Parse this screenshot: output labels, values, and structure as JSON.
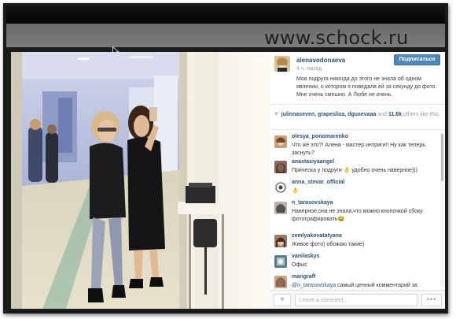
{
  "watermark": "www.schock.ru",
  "post": {
    "username": "alenavodonaeva",
    "time": "4 ч. назад",
    "follow_label": "Подписаться",
    "caption": "Моя подруга никогда до этого не знала об одном явлении, о котором я поведала ей за секунду до фото. Мне очень смешно. А Любе не очень."
  },
  "likes": {
    "users": "julinnaseven, grapesliza, dgusevaaa",
    "connector": " and ",
    "count": "11.6k",
    "suffix": " others like this."
  },
  "comments": [
    {
      "user": "olesya_ponomarenko",
      "text": "Что же это?! Алена - мастер интриги!! Ну как теперь заснуть?"
    },
    {
      "user": "anastasiyaangel",
      "text": "Прическа у подруги 👌 удобно очень наверное)))"
    },
    {
      "user": "anna_stevar_official",
      "text": "👌"
    },
    {
      "user": "n_tarasovskaya",
      "text": "Наверное,она не знала,что можно кнопочкой сбоку фотографировать😂"
    },
    {
      "user": "zemlyakovatatyana",
      "text": "Живое фото) обожаю такие)"
    },
    {
      "user": "vanilaskys",
      "text": "Офыс"
    },
    {
      "user": "marigraff",
      "mention": "@n_tarasovskaya",
      "text": " самый ценный комментарий за"
    }
  ],
  "input": {
    "placeholder": "Leave a comment...",
    "like_icon": "heart-icon",
    "more_label": "•••"
  },
  "colors": {
    "link": "#2b5072",
    "follow_button": "#4f87b8",
    "frame": "#1b1b1b"
  }
}
